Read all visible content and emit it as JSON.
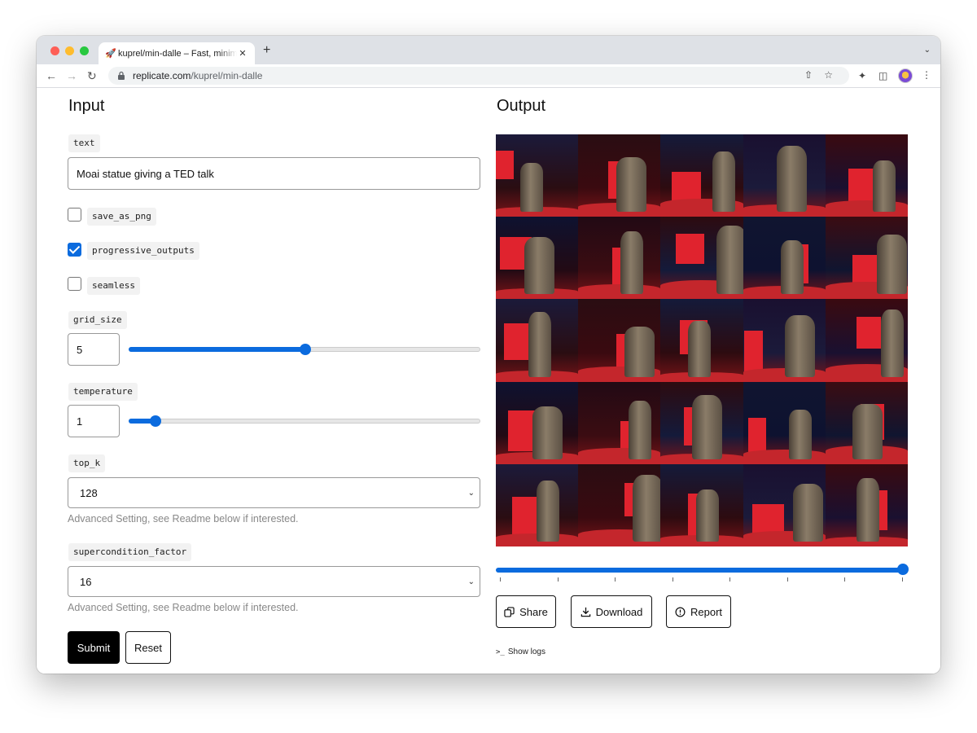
{
  "browser": {
    "tab_title": "kuprel/min-dalle – Fast, minimal port",
    "tab_favicon": "🚀",
    "tab_close": "✕",
    "new_tab": "+",
    "url_host": "replicate.com",
    "url_path": "/kuprel/min-dalle",
    "icons": [
      "back-icon",
      "forward-icon",
      "reload-icon",
      "lock-icon",
      "share-icon",
      "star-icon",
      "extensions-icon",
      "sidepanel-icon",
      "avatar",
      "menu-icon"
    ]
  },
  "input": {
    "heading": "Input",
    "text_label": "text",
    "text_value": "Moai statue giving a TED talk",
    "save_as_png_label": "save_as_png",
    "save_as_png_checked": false,
    "progressive_outputs_label": "progressive_outputs",
    "progressive_outputs_checked": true,
    "seamless_label": "seamless",
    "seamless_checked": false,
    "grid_size_label": "grid_size",
    "grid_size_value": "5",
    "grid_size_fraction": 0.5,
    "temperature_label": "temperature",
    "temperature_value": "1",
    "temperature_fraction": 0.075,
    "top_k_label": "top_k",
    "top_k_value": "128",
    "top_k_help": "Advanced Setting, see Readme below if interested.",
    "supercondition_label": "supercondition_factor",
    "supercondition_value": "16",
    "supercondition_help": "Advanced Setting, see Readme below if interested.",
    "submit_label": "Submit",
    "reset_label": "Reset"
  },
  "output": {
    "heading": "Output",
    "progress_fraction": 1.0,
    "share_label": "Share",
    "download_label": "Download",
    "report_label": "Report",
    "show_logs_label": "Show logs"
  },
  "colors": {
    "accent": "#0b6bde",
    "ted_red": "#e0232e"
  }
}
